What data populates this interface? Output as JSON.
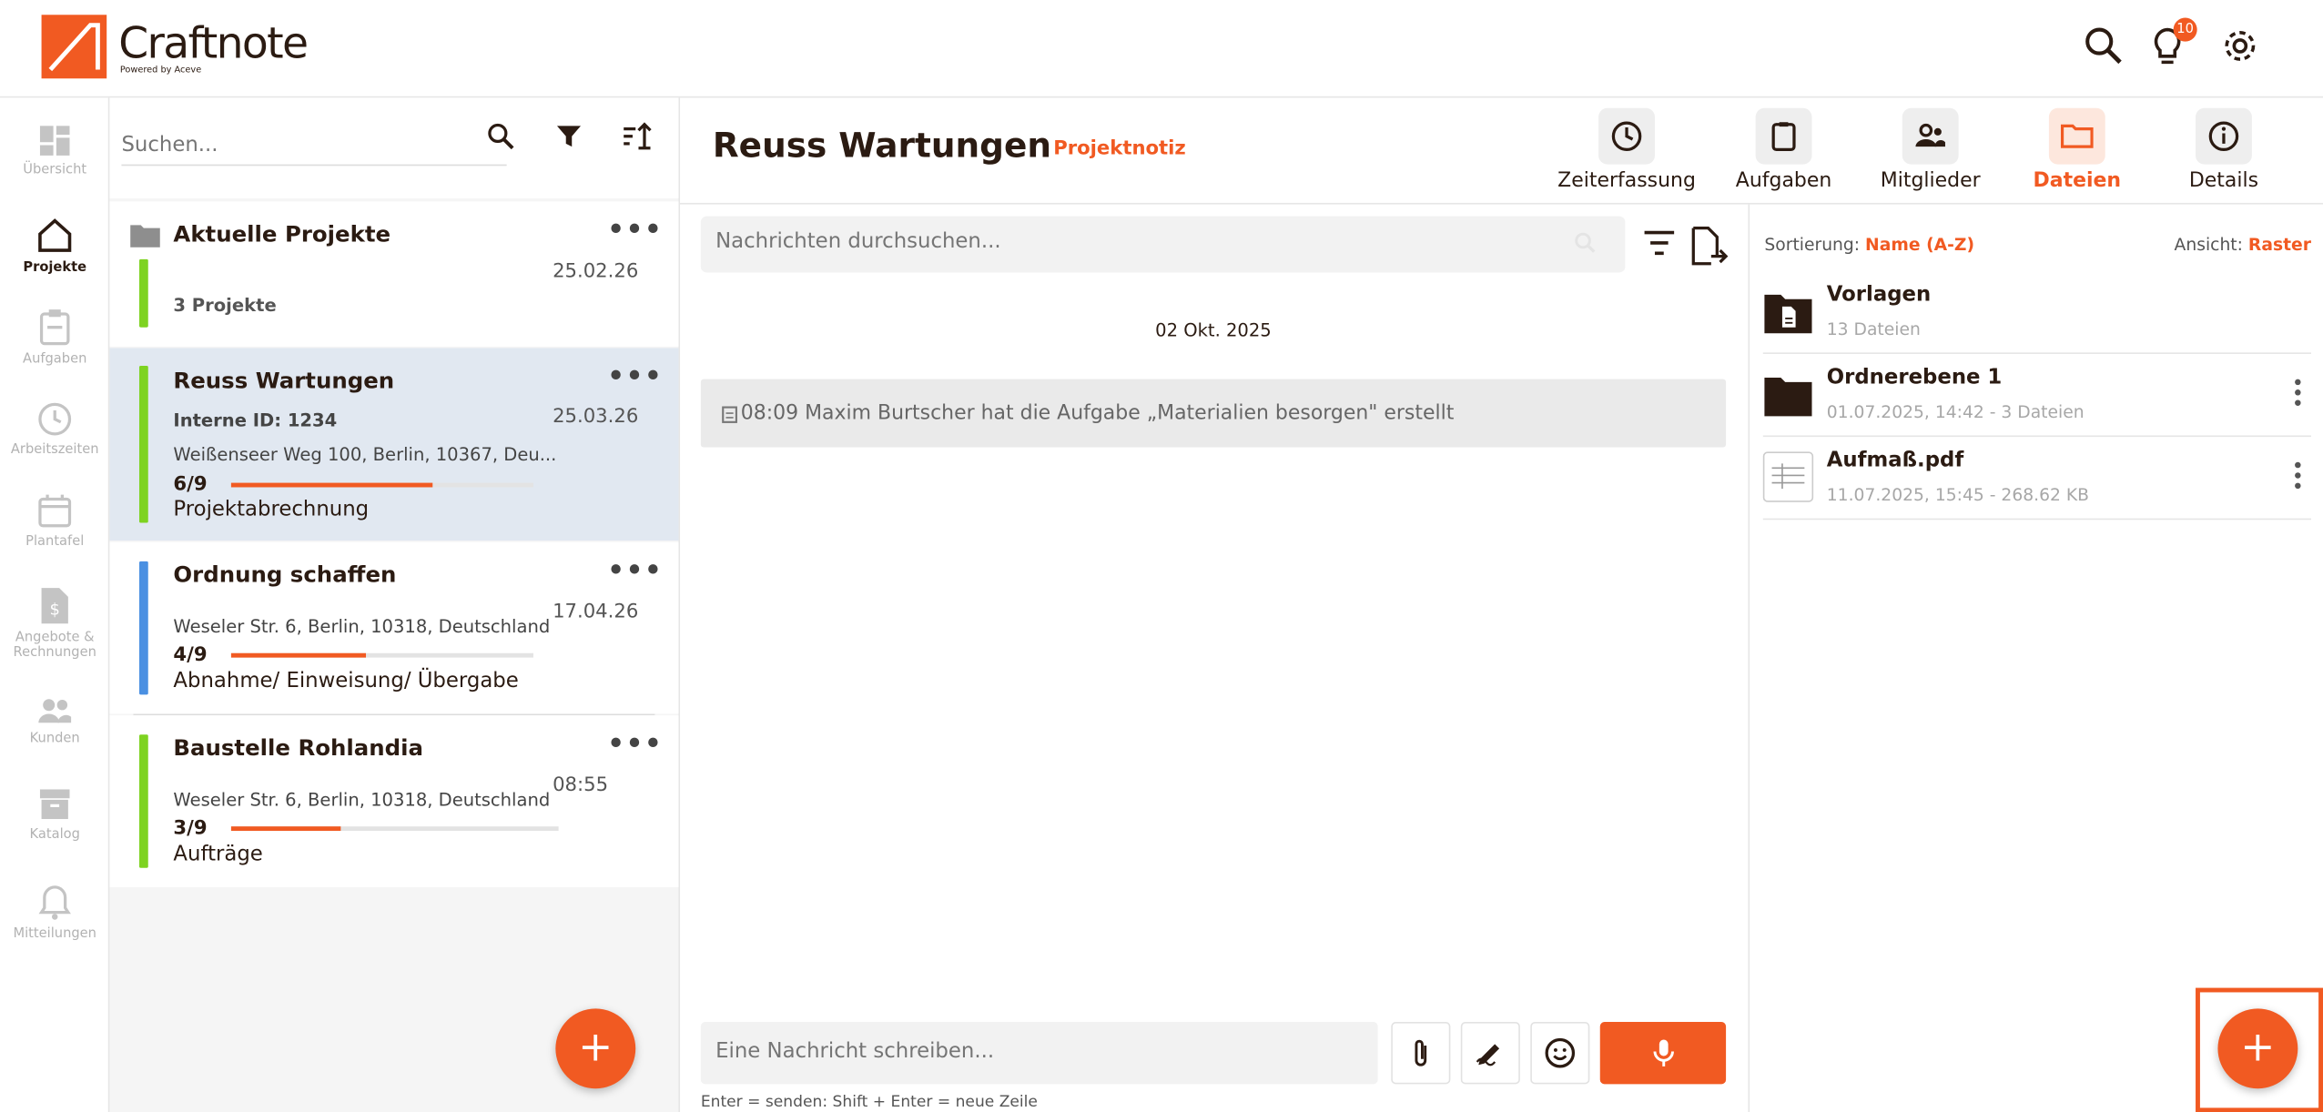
{
  "app": {
    "name": "Craftnote",
    "powered_by": "Powered by Aceve",
    "notifications_badge": "10"
  },
  "nav": [
    {
      "label": "Übersicht",
      "icon": "dashboard-icon",
      "active": false
    },
    {
      "label": "Projekte",
      "icon": "home-icon",
      "active": true
    },
    {
      "label": "Aufgaben",
      "icon": "clipboard-icon",
      "active": false
    },
    {
      "label": "Arbeitszeiten",
      "icon": "clock-icon",
      "active": false
    },
    {
      "label": "Plantafel",
      "icon": "calendar-icon",
      "active": false
    },
    {
      "label": "Angebote & Rechnungen",
      "icon": "invoice-icon",
      "active": false
    },
    {
      "label": "Kunden",
      "icon": "people-icon",
      "active": false
    },
    {
      "label": "Katalog",
      "icon": "archive-icon",
      "active": false
    },
    {
      "label": "Mitteilungen",
      "icon": "bell-icon",
      "active": false
    }
  ],
  "project_list": {
    "search_placeholder": "Suchen...",
    "folder": {
      "title": "Aktuelle Projekte",
      "date": "25.02.26",
      "count": "3 Projekte"
    },
    "projects": [
      {
        "title": "Reuss Wartungen",
        "internal_id": "Interne ID: 1234",
        "date": "25.03.26",
        "address": "Weißenseer Weg 100, Berlin, 10367, Deu...",
        "progress_label": "6/9",
        "progress": 0.667,
        "phase": "Projektabrechnung",
        "color": "#7ed321"
      },
      {
        "title": "Ordnung schaffen",
        "date": "17.04.26",
        "address": "Weseler Str. 6, Berlin, 10318, Deutschland",
        "progress_label": "4/9",
        "progress": 0.444,
        "phase": "Abnahme/ Einweisung/ Übergabe",
        "color": "#4a90e2"
      },
      {
        "title": "Baustelle Rohlandia",
        "date": "08:55",
        "address": "Weseler Str. 6, Berlin, 10318, Deutschland",
        "progress_label": "3/9",
        "progress": 0.333,
        "phase": "Aufträge",
        "color": "#7ed321"
      }
    ]
  },
  "project": {
    "title": "Reuss Wartungen",
    "tag": "Projektnotiz"
  },
  "tabs": [
    {
      "label": "Zeiterfassung",
      "icon": "clock-icon",
      "active": false
    },
    {
      "label": "Aufgaben",
      "icon": "clipboard-icon",
      "active": false
    },
    {
      "label": "Mitglieder",
      "icon": "people-icon",
      "active": false
    },
    {
      "label": "Dateien",
      "icon": "folder-icon",
      "active": true
    },
    {
      "label": "Details",
      "icon": "info-icon",
      "active": false
    }
  ],
  "chat": {
    "search_placeholder": "Nachrichten durchsuchen...",
    "date_label": "02 Okt. 2025",
    "message": "08:09 Maxim Burtscher hat die Aufgabe „Materialien besorgen\" erstellt",
    "compose_placeholder": "Eine Nachricht schreiben...",
    "hint": "Enter = senden: Shift + Enter = neue Zeile"
  },
  "files": {
    "sort_label": "Sortierung:",
    "sort_value": "Name (A-Z)",
    "view_label": "Ansicht:",
    "view_value": "Raster",
    "items": [
      {
        "name": "Vorlagen",
        "meta": "13 Dateien",
        "icon": "folder-doc-icon"
      },
      {
        "name": "Ordnerebene 1",
        "meta": "01.07.2025, 14:42 - 3 Dateien",
        "icon": "folder-icon"
      },
      {
        "name": "Aufmaß.pdf",
        "meta": "11.07.2025, 15:45 - 268.62 KB",
        "icon": "pdf-thumbnail-icon"
      }
    ]
  },
  "colors": {
    "accent": "#f15a22",
    "text": "#2b1b12",
    "selected_row": "#e1e8f1"
  }
}
